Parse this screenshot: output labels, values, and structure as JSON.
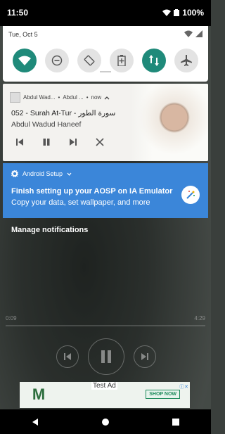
{
  "status_bar": {
    "time": "11:50",
    "battery": "100%"
  },
  "quick_settings": {
    "date": "Tue, Oct 5"
  },
  "media_notification": {
    "app_name": "Abdul Wad...",
    "subtext": "Abdul ...",
    "time": "now",
    "title": "052 - Surah At-Tur - سورة الطور",
    "artist": "Abdul Wadud Haneef"
  },
  "setup_notification": {
    "app_name": "Android Setup",
    "title": "Finish setting up your AOSP on IA Emulator",
    "text": "Copy your data, set wallpaper, and more"
  },
  "manage_label": "Manage notifications",
  "player": {
    "elapsed": "0:09",
    "duration": "4:29"
  },
  "ad": {
    "label": "Test Ad",
    "cta": "SHOP NOW",
    "logo": "M"
  },
  "colors": {
    "accent": "#1f8a7a",
    "setup_blue": "#3b86d9"
  }
}
